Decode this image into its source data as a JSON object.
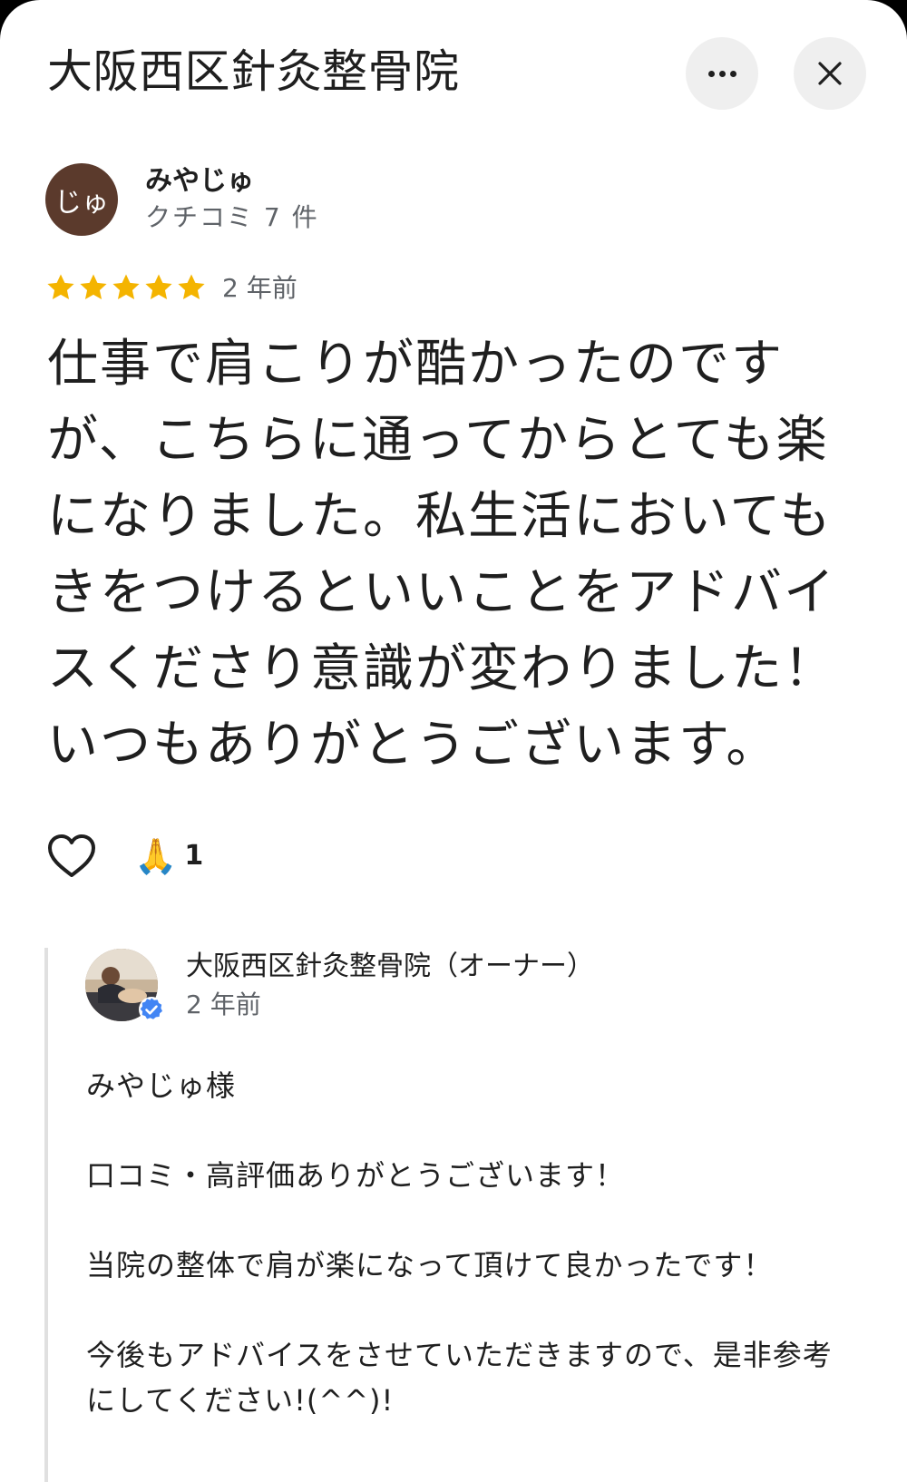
{
  "header": {
    "title": "大阪西区針灸整骨院",
    "more_icon": "more-horizontal-icon",
    "close_icon": "close-icon"
  },
  "review": {
    "avatar_initials": "じゅ",
    "avatar_color": "#5b3a2c",
    "author": "みやじゅ",
    "author_meta": "クチコミ 7 件",
    "rating": 5,
    "rating_max": 5,
    "star_color": "#f4b400",
    "date": "2 年前",
    "body": "仕事で肩こりが酷かったのですが、こちらに通ってからとても楽になりました。私生活においても きをつけるといいことをアドバイスくださり意識が変わりました！いつもありがとうございます。",
    "like_icon": "heart-outline-icon",
    "reaction_emoji": "🙏",
    "reaction_count": "1"
  },
  "owner_reply": {
    "name": "大阪西区針灸整骨院（オーナー）",
    "date": "2 年前",
    "verified_icon": "verified-badge-icon",
    "verified_color": "#4285f4",
    "paragraphs": [
      "みやじゅ様",
      "口コミ・高評価ありがとうございます！",
      "当院の整体で肩が楽になって頂けて良かったです！",
      "今後もアドバイスをさせていただきますので、是非参考にしてください!(^^)!"
    ]
  }
}
